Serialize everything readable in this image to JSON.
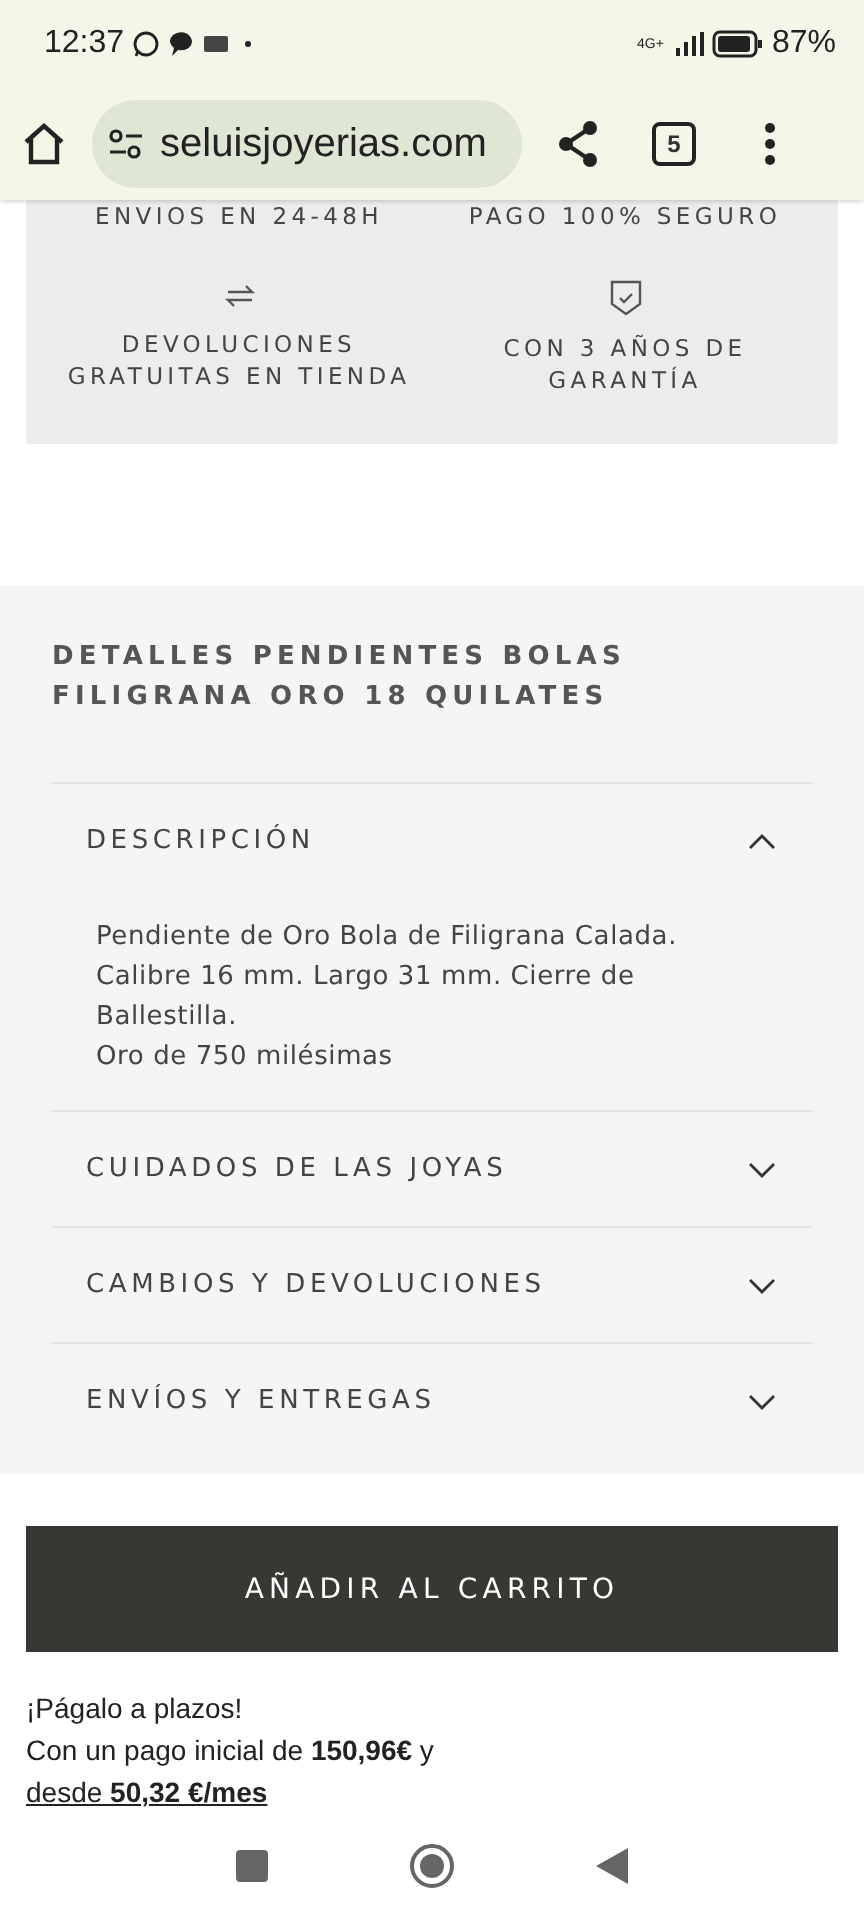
{
  "status_bar": {
    "time": "12:37",
    "network": "4G+",
    "battery": "87%"
  },
  "browser": {
    "url": "seluisjoyerias.com",
    "tabs_count": "5"
  },
  "features": [
    {
      "kind": "plain",
      "label": "ENVIOS EN 24-48H"
    },
    {
      "kind": "plain",
      "label": "PAGO 100% SEGURO"
    },
    {
      "kind": "returns",
      "label": "DEVOLUCIONES GRATUITAS EN TIENDA"
    },
    {
      "kind": "warranty",
      "label": "CON 3 AÑOS DE GARANTÍA"
    }
  ],
  "details": {
    "title": "DETALLES PENDIENTES BOLAS FILIGRANA ORO 18 QUILATES",
    "sections": [
      {
        "title": "DESCRIPCIÓN",
        "expanded": true,
        "body": [
          "Pendiente de Oro Bola de Filigrana Calada. Calibre 16 mm. Largo 31 mm. Cierre de Ballestilla.",
          "Oro de 750 milésimas"
        ]
      },
      {
        "title": "CUIDADOS DE LAS JOYAS",
        "expanded": false
      },
      {
        "title": "CAMBIOS Y DEVOLUCIONES",
        "expanded": false
      },
      {
        "title": "ENVÍOS Y ENTREGAS",
        "expanded": false
      }
    ]
  },
  "add_to_cart": "AÑADIR AL CARRITO",
  "installments": {
    "title": "¡Págalo a plazos!",
    "text": "Con un pago inicial de **150,96€** y",
    "link": "desde **50,32 €/mes**"
  }
}
